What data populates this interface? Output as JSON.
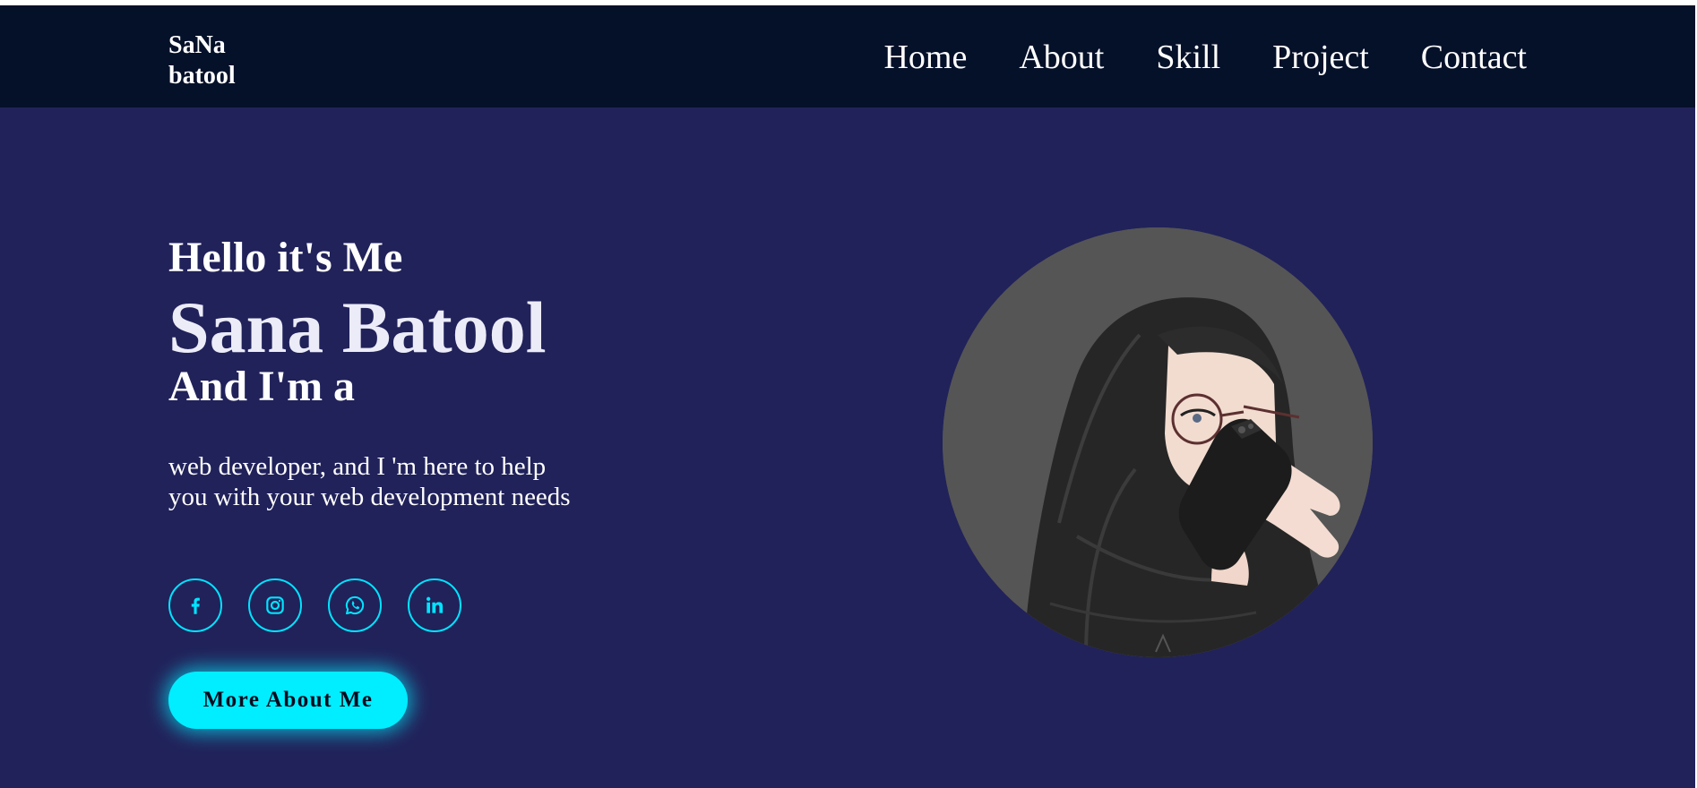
{
  "header": {
    "logo_line1": "SaNa",
    "logo_line2": "batool",
    "nav": [
      {
        "label": "Home"
      },
      {
        "label": "About"
      },
      {
        "label": "Skill"
      },
      {
        "label": "Project"
      },
      {
        "label": "Contact"
      }
    ]
  },
  "hero": {
    "greeting": "Hello it's Me",
    "name": "Sana Batool",
    "role": "And I'm a",
    "description_line1": "web developer, and I 'm here to help",
    "description_line2": "you with your web development needs",
    "socials": [
      {
        "icon": "facebook-icon"
      },
      {
        "icon": "instagram-icon"
      },
      {
        "icon": "whatsapp-icon"
      },
      {
        "icon": "linkedin-icon"
      }
    ],
    "cta_label": "More About Me",
    "avatar_icon": "avatar-illustration"
  },
  "colors": {
    "header_bg": "#051029",
    "hero_bg": "#21225a",
    "accent": "#00eeff",
    "avatar_bg": "#555555"
  }
}
